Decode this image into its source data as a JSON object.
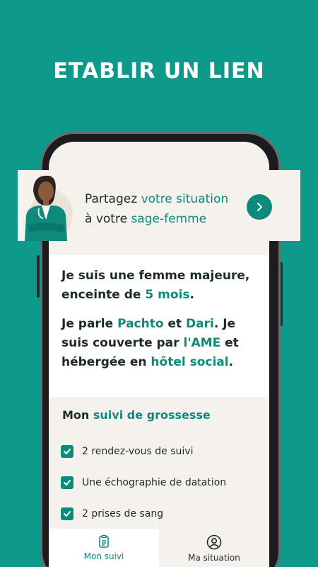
{
  "headline": "ETABLIR UN LIEN",
  "banner": {
    "line1_prefix": "Partagez ",
    "line1_highlight": "votre situation",
    "line2_prefix": "à votre ",
    "line2_highlight": "sage-femme",
    "arrow_icon": "chevron-right-icon"
  },
  "statement1": {
    "line1": "Je suis une femme majeure,",
    "line2_prefix": "enceinte de ",
    "line2_highlight": "5 mois",
    "line2_suffix": "."
  },
  "statement2": {
    "p1": "Je parle ",
    "h1": "Pachto",
    "p2": " et ",
    "h2": "Dari",
    "p3": ". Je",
    "line2_prefix": "suis couverte par ",
    "line2_highlight": "l'AME",
    "line2_suffix": " et",
    "line3_prefix": "hébergée en ",
    "line3_highlight": "hôtel social",
    "line3_suffix": "."
  },
  "followup": {
    "title_prefix": "Mon ",
    "title_highlight": "suivi de grossesse",
    "items": [
      {
        "label": "2 rendez-vous de suivi",
        "checked": true
      },
      {
        "label": "Une échographie de datation",
        "checked": true
      },
      {
        "label": "2 prises de sang",
        "checked": true
      }
    ]
  },
  "tabs": [
    {
      "label": "Mon suivi",
      "icon": "clipboard-icon",
      "active": true
    },
    {
      "label": "Ma situation",
      "icon": "user-circle-icon",
      "active": false
    }
  ],
  "colors": {
    "background": "#0e9a8a",
    "accent": "#0e8a7c",
    "cream": "#f5f2ee"
  }
}
